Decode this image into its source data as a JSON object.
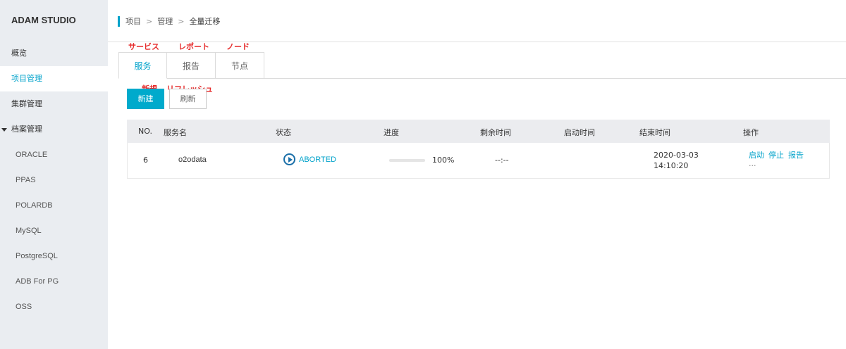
{
  "sidebar": {
    "brand": "ADAM STUDIO",
    "items": [
      {
        "label": "概览"
      },
      {
        "label": "项目管理",
        "active": true
      },
      {
        "label": "集群管理"
      }
    ],
    "group": {
      "label": "档案管理"
    },
    "sub_items": [
      {
        "label": "ORACLE"
      },
      {
        "label": "PPAS"
      },
      {
        "label": "POLARDB"
      },
      {
        "label": "MySQL"
      },
      {
        "label": "PostgreSQL"
      },
      {
        "label": "ADB For PG"
      },
      {
        "label": "OSS"
      }
    ]
  },
  "breadcrumb": {
    "items": [
      "项目",
      "管理"
    ],
    "current": "全量迁移",
    "separator": ">"
  },
  "annotations": {
    "tab_service": "サービス",
    "tab_report": "レポート",
    "tab_node": "ノード",
    "btn_new": "新規",
    "btn_refresh": "リフレッシュ"
  },
  "tabs": [
    {
      "label": "服务",
      "active": true
    },
    {
      "label": "报告"
    },
    {
      "label": "节点"
    }
  ],
  "toolbar": {
    "new_label": "新建",
    "refresh_label": "刷新"
  },
  "table": {
    "columns": [
      "NO.",
      "服务名",
      "状态",
      "进度",
      "剩余时间",
      "启动时间",
      "结束时间",
      "操作"
    ],
    "rows": [
      {
        "no": "6",
        "name": "o2odata",
        "status": "ABORTED",
        "progress_label": "100%",
        "progress": 1.0,
        "remaining": "--:--",
        "start": "",
        "end_date": "2020-03-03",
        "end_time": "14:10:20",
        "ops": [
          "启动",
          "停止",
          "报告"
        ],
        "more": "···"
      }
    ]
  },
  "colors": {
    "accent": "#00a2ca",
    "primary_button": "#00aacc",
    "progress": "#22b14c",
    "annotation": "#e62b2b"
  }
}
